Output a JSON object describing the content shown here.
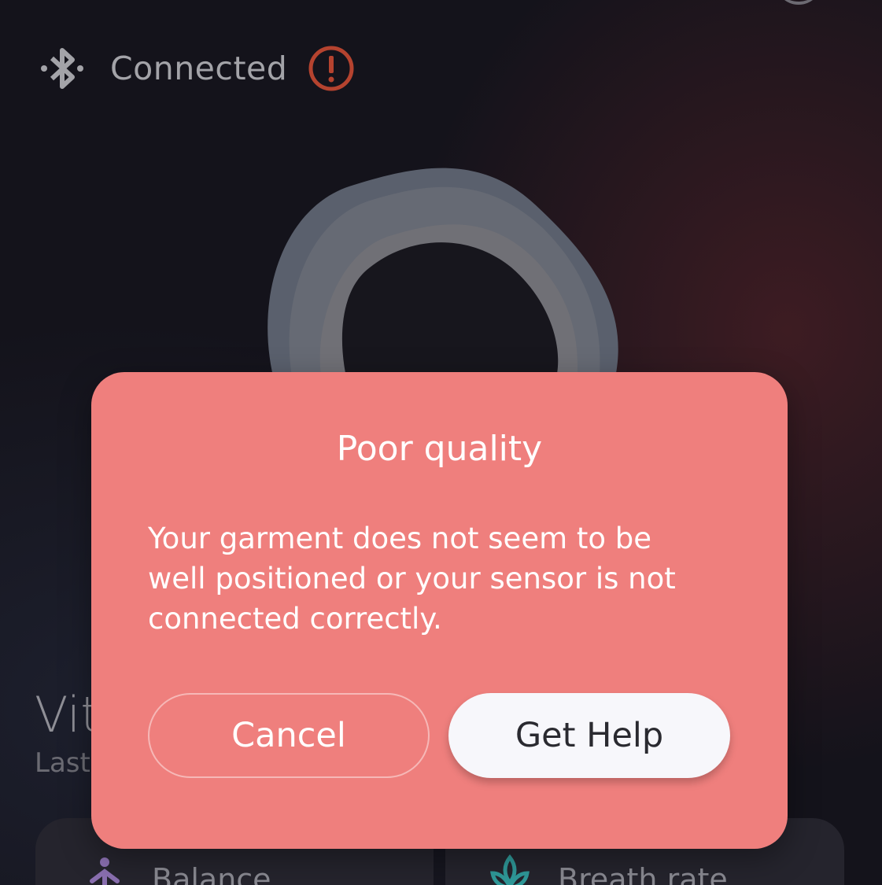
{
  "status": {
    "connection_text": "Connected",
    "bluetooth_icon": "bluetooth-icon",
    "alert_icon": "alert-circle-icon",
    "alert_color": "#b5432f"
  },
  "vitals": {
    "title": "Vit",
    "subtitle": "Last"
  },
  "cards": [
    {
      "label": "Balance",
      "icon": "meditation-person-icon"
    },
    {
      "label": "Breath rate",
      "icon": "lotus-icon"
    }
  ],
  "dialog": {
    "title": "Poor quality",
    "message": "Your garment does not seem to be well positioned or your sensor is not connected correctly.",
    "cancel_label": "Cancel",
    "help_label": "Get Help",
    "background_color": "#ef7f7d"
  }
}
